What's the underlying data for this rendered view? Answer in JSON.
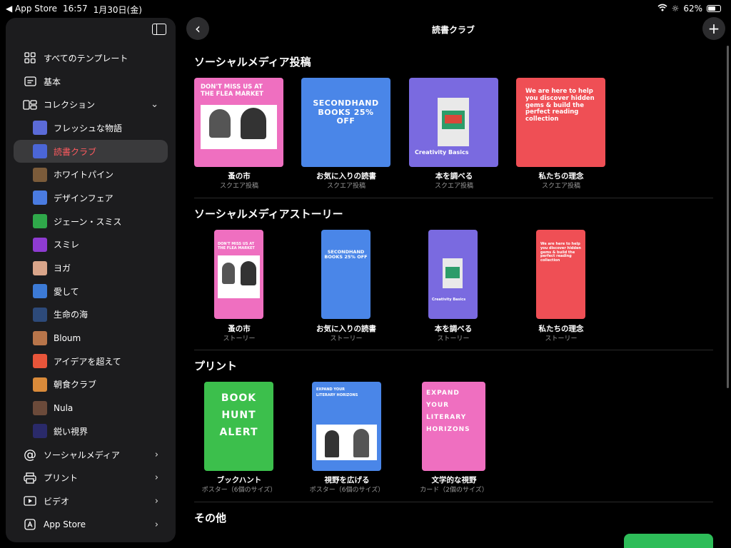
{
  "status": {
    "back_app": "◀ App Store",
    "time": "16:57",
    "date": "1月30日(金)",
    "battery": "62%",
    "battery_level": 0.62
  },
  "topnav": {
    "title": "読書クラブ"
  },
  "sidebar": {
    "items": [
      {
        "label": "すべてのテンプレート",
        "icon": "grid-icon"
      },
      {
        "label": "基本",
        "icon": "text-box-icon"
      },
      {
        "label": "コレクション",
        "icon": "collection-icon"
      }
    ],
    "collection": [
      {
        "label": "フレッシュな物語",
        "color": "#5b6bd8"
      },
      {
        "label": "読書クラブ",
        "color": "#4b66d6"
      },
      {
        "label": "ホワイトパイン",
        "color": "#7b5b3a"
      },
      {
        "label": "デザインフェア",
        "color": "#4a7be0"
      },
      {
        "label": "ジェーン・スミス",
        "color": "#2fa84a"
      },
      {
        "label": "スミレ",
        "color": "#8e3bd1"
      },
      {
        "label": "ヨガ",
        "color": "#d9a58a"
      },
      {
        "label": "愛して",
        "color": "#3c7ad6"
      },
      {
        "label": "生命の海",
        "color": "#2d4a7a"
      },
      {
        "label": "Bloum",
        "color": "#b8754a"
      },
      {
        "label": "アイデアを超えて",
        "color": "#e8553a"
      },
      {
        "label": "朝食クラブ",
        "color": "#d98a3a"
      },
      {
        "label": "Nula",
        "color": "#6b4a3a"
      },
      {
        "label": "鋭い視界",
        "color": "#2a2a6a"
      }
    ],
    "bottom": [
      {
        "label": "ソーシャルメディア",
        "icon": "at-icon"
      },
      {
        "label": "プリント",
        "icon": "printer-icon"
      },
      {
        "label": "ビデオ",
        "icon": "play-icon"
      },
      {
        "label": "App Store",
        "icon": "appstore-icon"
      }
    ]
  },
  "sections": {
    "social_posts": {
      "title": "ソーシャルメディア投稿",
      "cards": [
        {
          "name": "蚤の市",
          "sub": "スクエア投稿",
          "thumb": "DON'T MISS US AT THE FLEA MARKET",
          "bg": "#ef6fc0"
        },
        {
          "name": "お気に入りの読書",
          "sub": "スクエア投稿",
          "thumb": "SECONDHAND BOOKS 25% OFF",
          "bg": "#4a86e8"
        },
        {
          "name": "本を調べる",
          "sub": "スクエア投稿",
          "thumb": "Creativity Basics",
          "bg": "#7a6ae0"
        },
        {
          "name": "私たちの理念",
          "sub": "スクエア投稿",
          "thumb": "We are here to help you discover hidden gems & build the perfect reading collection",
          "bg": "#ef4f55"
        }
      ]
    },
    "stories": {
      "title": "ソーシャルメディアストーリー",
      "cards": [
        {
          "name": "蚤の市",
          "sub": "ストーリー",
          "thumb": "DON'T MISS US AT THE FLEA MARKET",
          "bg": "#ef6fc0"
        },
        {
          "name": "お気に入りの読書",
          "sub": "ストーリー",
          "thumb": "SECONDHAND BOOKS 25% OFF",
          "bg": "#4a86e8"
        },
        {
          "name": "本を調べる",
          "sub": "ストーリー",
          "thumb": "Creativity Basics",
          "bg": "#7a6ae0"
        },
        {
          "name": "私たちの理念",
          "sub": "ストーリー",
          "thumb": "We are here to help you discover hidden gems & build the perfect reading collection",
          "bg": "#ef4f55"
        }
      ]
    },
    "print": {
      "title": "プリント",
      "cards": [
        {
          "name": "ブックハント",
          "sub": "ポスター（6個のサイズ）",
          "thumb": "BOOK HUNT ALERT",
          "bg": "#3cbf4c"
        },
        {
          "name": "視野を広げる",
          "sub": "ポスター（6個のサイズ）",
          "thumb": "EXPAND YOUR LITERARY HORIZONS",
          "bg": "#4a86e8"
        },
        {
          "name": "文学的な視野",
          "sub": "カード（2個のサイズ）",
          "thumb": "EXPAND YOUR LITERARY HORIZONS",
          "bg": "#ef6fc0"
        }
      ]
    },
    "other": {
      "title": "その他"
    }
  }
}
